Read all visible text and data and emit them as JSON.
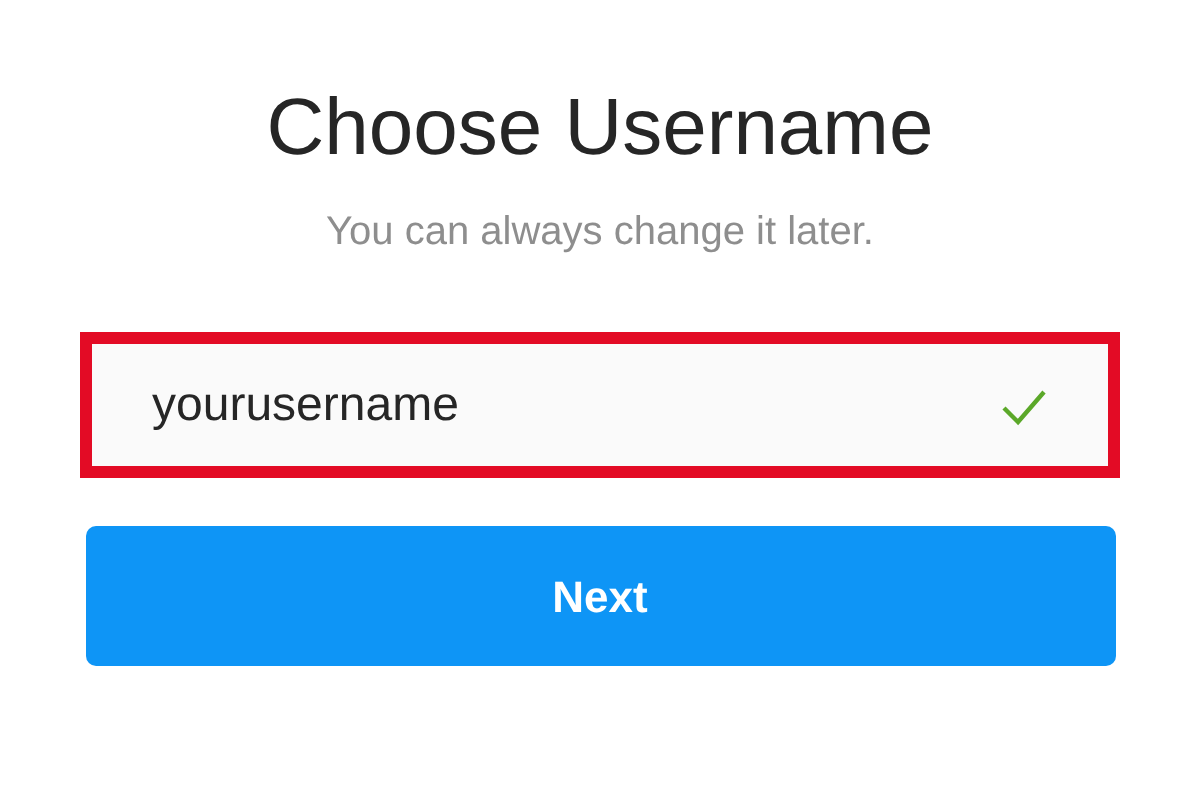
{
  "title": "Choose Username",
  "subtitle": "You can always change it later.",
  "username_field": {
    "value": "yourusername",
    "valid": true,
    "highlighted": true
  },
  "next_button": {
    "label": "Next"
  }
}
